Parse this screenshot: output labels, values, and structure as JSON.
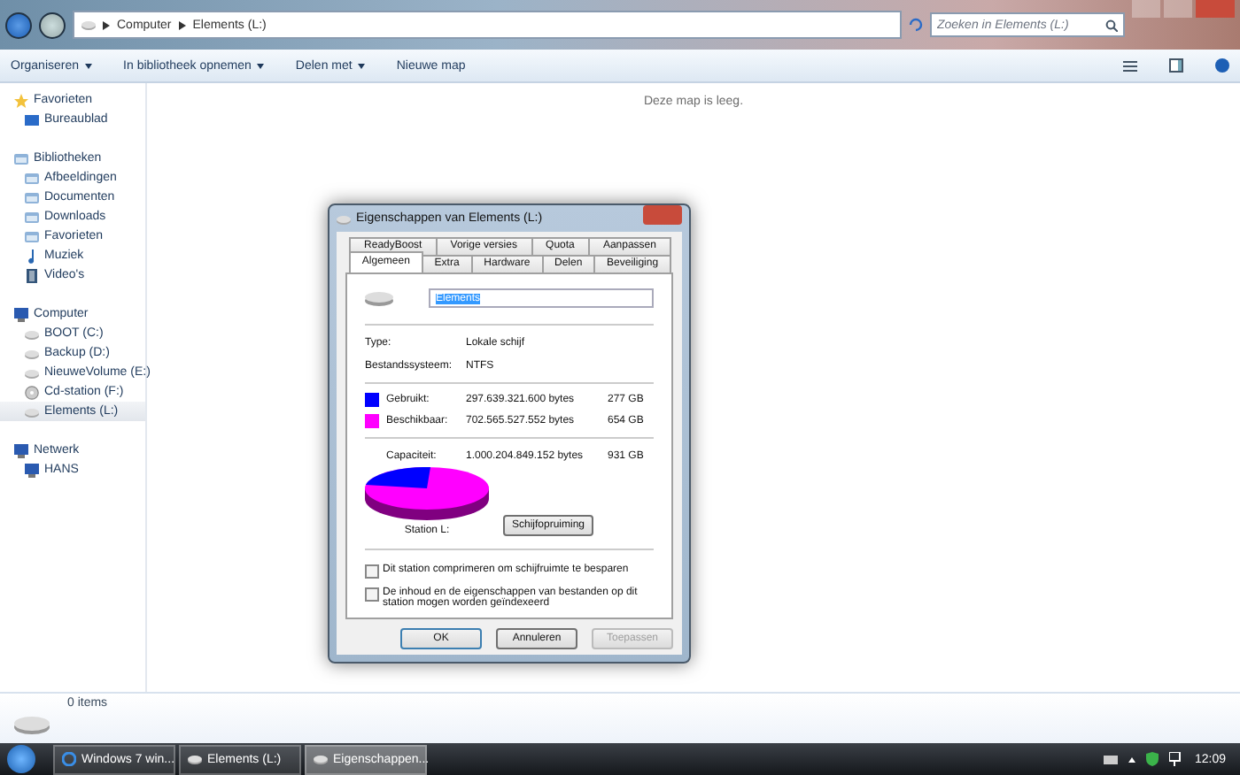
{
  "window": {
    "breadcrumb": [
      "Computer",
      "Elements (L:)"
    ],
    "search": {
      "placeholder": "Zoeken in Elements (L:)"
    }
  },
  "toolbar": {
    "items": [
      {
        "label": "Organiseren",
        "dropdown": true
      },
      {
        "label": "In bibliotheek opnemen",
        "dropdown": true
      },
      {
        "label": "Delen met",
        "dropdown": true
      },
      {
        "label": "Nieuwe map",
        "dropdown": false
      }
    ]
  },
  "sidebar": {
    "items": [
      {
        "label": "Favorieten",
        "kind": "star",
        "selected": false,
        "children": [
          {
            "label": "Bureaublad",
            "kind": "desktop",
            "selected": false
          }
        ]
      },
      {
        "label": "Bibliotheken",
        "kind": "library",
        "selected": false,
        "children": [
          {
            "label": "Afbeeldingen",
            "kind": "library",
            "selected": false
          },
          {
            "label": "Documenten",
            "kind": "library",
            "selected": false
          },
          {
            "label": "Downloads",
            "kind": "library",
            "selected": false
          },
          {
            "label": "Favorieten",
            "kind": "library",
            "selected": false
          },
          {
            "label": "Muziek",
            "kind": "music",
            "selected": false
          },
          {
            "label": "Video's",
            "kind": "video",
            "selected": false
          }
        ]
      },
      {
        "label": "Computer",
        "kind": "computer",
        "selected": false,
        "children": [
          {
            "label": "BOOT (C:)",
            "kind": "drive",
            "selected": false
          },
          {
            "label": "Backup (D:)",
            "kind": "drive",
            "selected": false
          },
          {
            "label": "NieuweVolume (E:)",
            "kind": "drive",
            "selected": false
          },
          {
            "label": "Cd-station (F:)",
            "kind": "cd",
            "selected": false
          },
          {
            "label": "Elements (L:)",
            "kind": "drive",
            "selected": true
          }
        ]
      },
      {
        "label": "Netwerk",
        "kind": "computer",
        "selected": false,
        "children": [
          {
            "label": "HANS",
            "kind": "computer",
            "selected": false
          }
        ]
      }
    ]
  },
  "content": {
    "empty_message": "Deze map is leeg."
  },
  "details_pane": {
    "count": "0 items"
  },
  "dialog": {
    "title": "Eigenschappen van Elements (L:)",
    "tab_rows": [
      [
        {
          "label": "ReadyBoost",
          "selected": false
        },
        {
          "label": "Vorige versies",
          "selected": false
        },
        {
          "label": "Quota",
          "selected": false
        },
        {
          "label": "Aanpassen",
          "selected": false
        }
      ],
      [
        {
          "label": "Algemeen",
          "selected": true
        },
        {
          "label": "Extra",
          "selected": false
        },
        {
          "label": "Hardware",
          "selected": false
        },
        {
          "label": "Delen",
          "selected": false
        },
        {
          "label": "Beveiliging",
          "selected": false
        }
      ]
    ],
    "name_value": "Elements",
    "info": [
      {
        "label": "Type:",
        "value": "Lokale schijf"
      },
      {
        "label": "Bestandssysteem:",
        "value": "NTFS"
      }
    ],
    "usage": [
      {
        "label": "Gebruikt:",
        "bytes": "297.639.321.600 bytes",
        "size": "277 GB",
        "color": "#0000ff"
      },
      {
        "label": "Beschikbaar:",
        "bytes": "702.565.527.552 bytes",
        "size": "654 GB",
        "color": "#ff00ff"
      }
    ],
    "capacity": {
      "label": "Capaciteit:",
      "bytes": "1.000.204.849.152 bytes",
      "size": "931 GB"
    },
    "drive_label": "Station L:",
    "cleanup_button": "Schijfopruiming",
    "options": [
      {
        "label": "Dit station comprimeren om schijfruimte te besparen",
        "checked": false
      },
      {
        "label": "De inhoud en de eigenschappen van bestanden op dit station mogen worden geïndexeerd",
        "checked": false
      }
    ],
    "buttons": [
      {
        "label": "OK",
        "disabled": false,
        "default": true
      },
      {
        "label": "Annuleren",
        "disabled": false,
        "default": false
      },
      {
        "label": "Toepassen",
        "disabled": true,
        "default": false
      }
    ]
  },
  "taskbar": {
    "tasks": [
      {
        "label": "Windows 7 win...",
        "kind": "browser",
        "selected": false
      },
      {
        "label": "Elements (L:)",
        "kind": "drive",
        "selected": false
      },
      {
        "label": "Eigenschappen...",
        "kind": "drive",
        "selected": true
      }
    ],
    "clock": "12:09"
  }
}
